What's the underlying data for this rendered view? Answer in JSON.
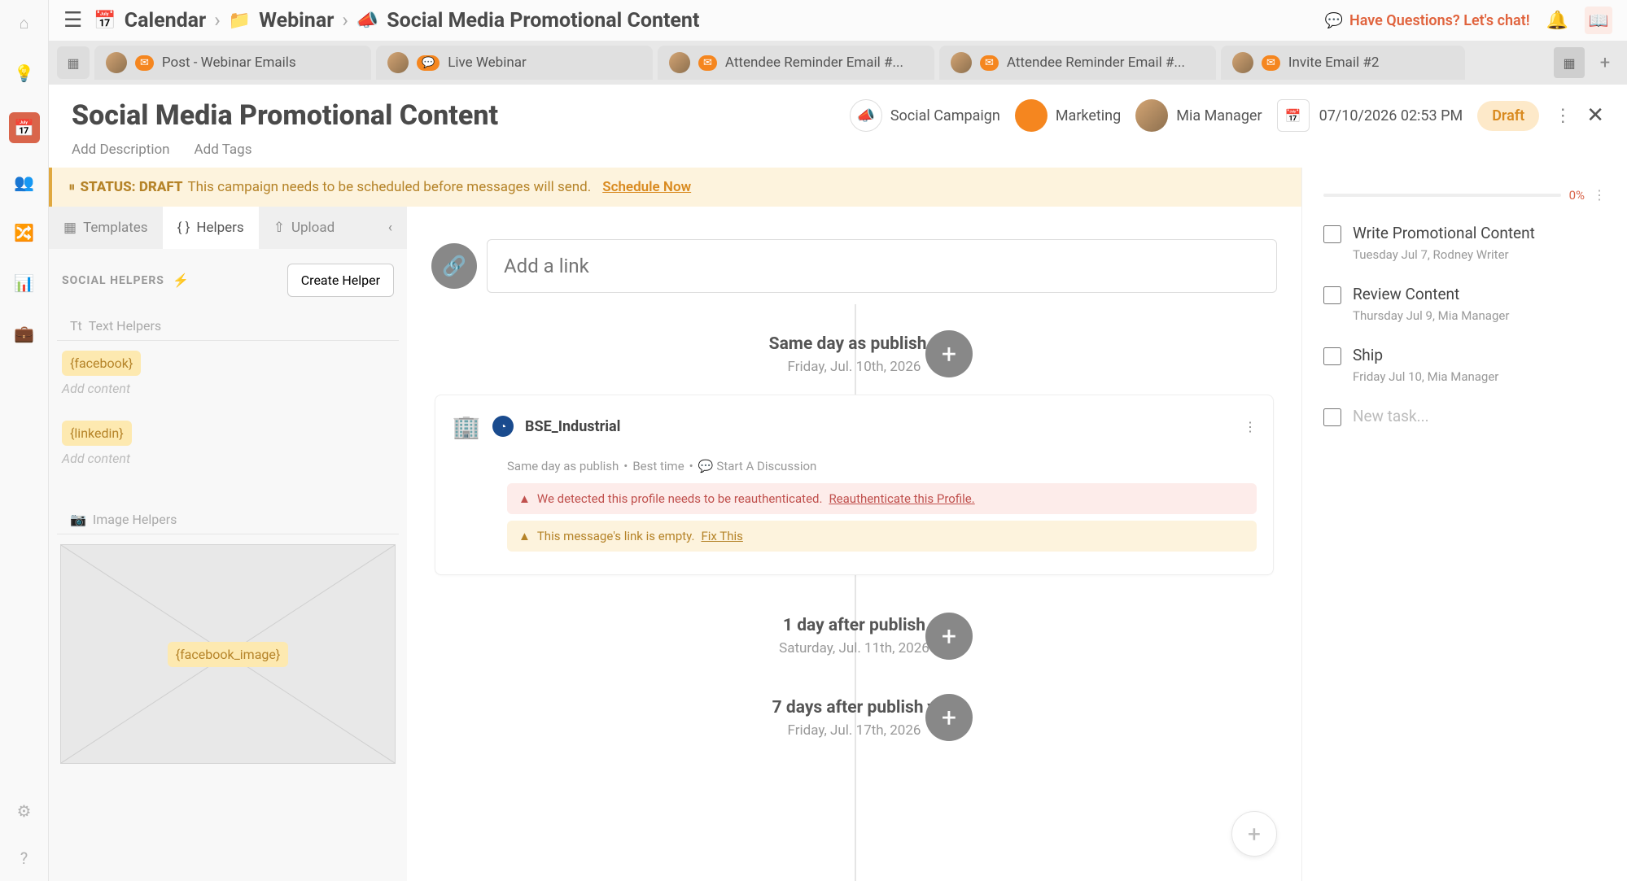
{
  "breadcrumb": {
    "root": "Calendar",
    "folder": "Webinar",
    "page": "Social Media Promotional Content"
  },
  "topbar": {
    "chat": "Have Questions? Let's chat!"
  },
  "tabs": [
    {
      "label": "Post - Webinar Emails"
    },
    {
      "label": "Live Webinar"
    },
    {
      "label": "Attendee Reminder Email #..."
    },
    {
      "label": "Attendee Reminder Email #..."
    },
    {
      "label": "Invite Email #2"
    }
  ],
  "header": {
    "title": "Social Media Promotional Content",
    "add_description": "Add Description",
    "add_tags": "Add Tags",
    "campaign": "Social Campaign",
    "team": "Marketing",
    "owner": "Mia Manager",
    "datetime": "07/10/2026 02:53 PM",
    "status": "Draft"
  },
  "status_bar": {
    "label": "STATUS: DRAFT",
    "text": "This campaign needs to be scheduled before messages will send.",
    "action": "Schedule Now"
  },
  "left_panel": {
    "tabs": {
      "templates": "Templates",
      "helpers": "Helpers",
      "upload": "Upload"
    },
    "heading": "SOCIAL HELPERS",
    "create": "Create Helper",
    "text_section": "Text Helpers",
    "image_section": "Image Helpers",
    "helpers": [
      {
        "badge": "{facebook}",
        "hint": "Add content"
      },
      {
        "badge": "{linkedin}",
        "hint": "Add content"
      }
    ],
    "image_helper_badge": "{facebook_image}"
  },
  "timeline": {
    "link_placeholder": "Add a link",
    "nodes": [
      {
        "label": "Same day as publish",
        "date": "Friday, Jul. 10th, 2026"
      },
      {
        "label": "1 day after publish",
        "date": "Saturday, Jul. 11th, 2026"
      },
      {
        "label": "7 days after publish",
        "date": "Friday, Jul. 17th, 2026"
      }
    ],
    "card": {
      "profile": "BSE_Industrial",
      "meta1": "Same day as publish",
      "meta2": "Best time",
      "discussion": "Start A Discussion",
      "alert1_text": "We detected this profile needs to be reauthenticated.",
      "alert1_link": "Reauthenticate this Profile.",
      "alert2_text": "This message's link is empty.",
      "alert2_link": "Fix This"
    }
  },
  "right_panel": {
    "progress": "0%",
    "tasks": [
      {
        "title": "Write Promotional Content",
        "meta": "Tuesday Jul 7,  Rodney Writer"
      },
      {
        "title": "Review Content",
        "meta": "Thursday Jul 9,  Mia Manager"
      },
      {
        "title": "Ship",
        "meta": "Friday Jul 10,  Mia Manager"
      }
    ],
    "new_task": "New task..."
  }
}
